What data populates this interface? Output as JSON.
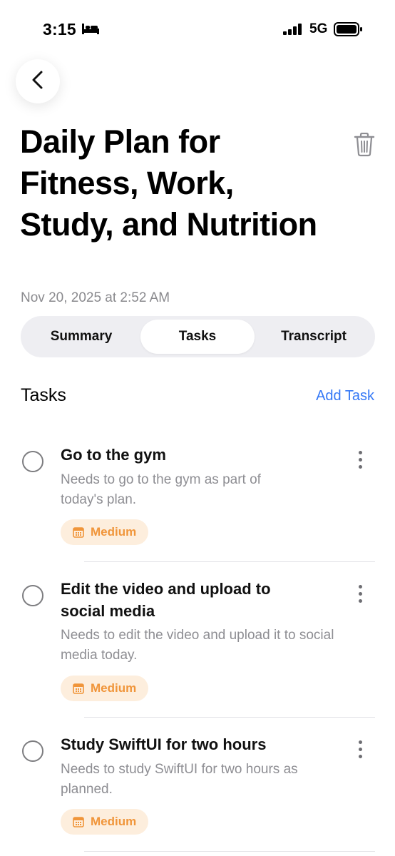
{
  "status_bar": {
    "time": "3:15",
    "network": "5G"
  },
  "header": {
    "title": "Daily Plan for Fitness, Work, Study, and Nutrition",
    "timestamp": "Nov 20, 2025 at 2:52 AM"
  },
  "tabs": [
    {
      "label": "Summary",
      "selected": false
    },
    {
      "label": "Tasks",
      "selected": true
    },
    {
      "label": "Transcript",
      "selected": false
    }
  ],
  "section": {
    "title": "Tasks",
    "action": "Add Task"
  },
  "tasks": [
    {
      "title": "Go to the gym",
      "description": "Needs to go to the gym as part of today's plan.",
      "priority": "Medium"
    },
    {
      "title": "Edit the video and upload to social media",
      "description": "Needs to edit the video and upload it to social media today.",
      "priority": "Medium"
    },
    {
      "title": "Study SwiftUI for two hours",
      "description": "Needs to study SwiftUI for two hours as planned.",
      "priority": "Medium"
    }
  ],
  "colors": {
    "accent": "#3478f6",
    "priority_text": "#f0953a",
    "priority_bg": "#fdeedd"
  },
  "icons": [
    "bed-icon",
    "signal-icon",
    "battery-icon",
    "chevron-left-icon",
    "trash-icon",
    "calendar-icon",
    "more-vertical-icon"
  ]
}
